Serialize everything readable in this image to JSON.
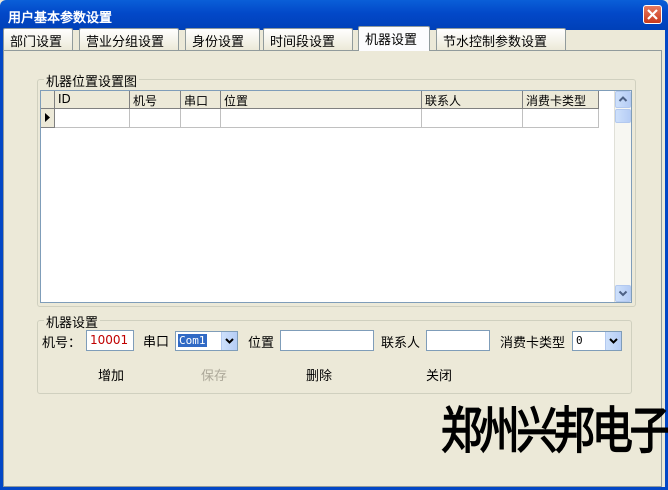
{
  "window": {
    "title": "用户基本参数设置"
  },
  "tabs": [
    {
      "label": "部门设置"
    },
    {
      "label": "营业分组设置"
    },
    {
      "label": "身份设置"
    },
    {
      "label": "时间段设置"
    },
    {
      "label": "机器设置",
      "active": true
    },
    {
      "label": "节水控制参数设置"
    }
  ],
  "grid_group": {
    "legend": "机器位置设置图",
    "columns": [
      "ID",
      "机号",
      "串口",
      "位置",
      "联系人",
      "消费卡类型"
    ]
  },
  "form_group": {
    "legend": "机器设置",
    "machine_no_label": "机号：",
    "machine_no_value": "10001",
    "port_label": "串口",
    "port_value": "Com1",
    "location_label": "位置",
    "location_value": "",
    "contact_label": "联系人",
    "contact_value": "",
    "card_type_label": "消费卡类型",
    "card_type_value": "0"
  },
  "buttons": {
    "add": "增加",
    "save": "保存",
    "delete": "删除",
    "close": "关闭"
  },
  "watermark": "郑州兴邦电子",
  "colors": {
    "titlebar": "#0248c8",
    "background": "#ece9d8",
    "selection": "#316ac5"
  }
}
